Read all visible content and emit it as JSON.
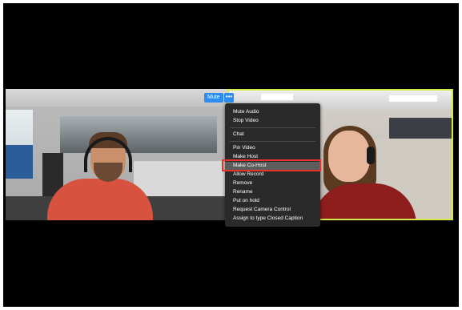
{
  "top_controls": {
    "mute_label": "Mute",
    "more_label": "•••"
  },
  "menu": {
    "items": [
      {
        "label": "Mute Audio"
      },
      {
        "label": "Stop Video"
      },
      {
        "label": "Chat"
      },
      {
        "label": "Pin Video"
      },
      {
        "label": "Make Host"
      },
      {
        "label": "Make Co-Host",
        "highlighted": true
      },
      {
        "label": "Allow Record"
      },
      {
        "label": "Remove"
      },
      {
        "label": "Rename"
      },
      {
        "label": "Put on hold"
      },
      {
        "label": "Request Camera Control"
      },
      {
        "label": "Assign to type Closed Caption"
      }
    ]
  },
  "colors": {
    "accent_blue": "#2e8cf0",
    "active_speaker_border": "#d6e84a",
    "highlight_red": "#e63228",
    "menu_bg": "#2a2a2a"
  }
}
